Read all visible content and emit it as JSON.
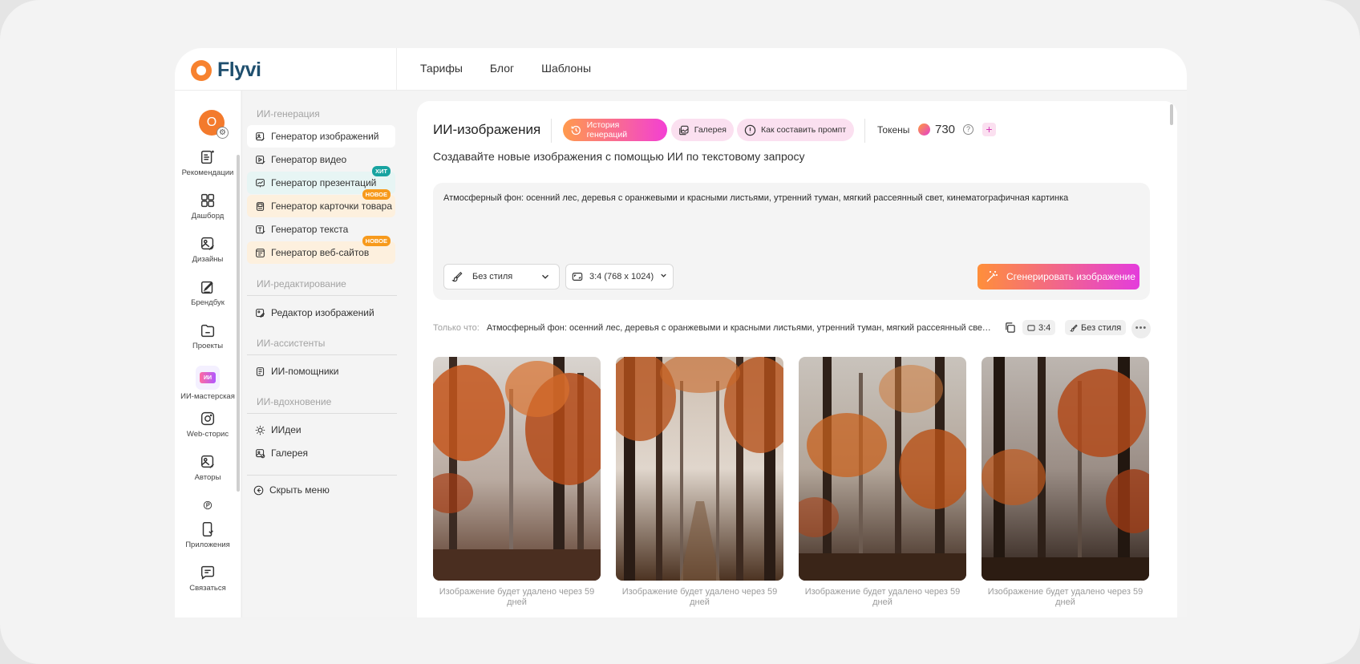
{
  "brand": {
    "name": "Flyvi"
  },
  "nav": [
    "Тарифы",
    "Блог",
    "Шаблоны"
  ],
  "avatar": {
    "letter": "O"
  },
  "rail": {
    "items": [
      {
        "label": "Рекомендации",
        "icon": "recommendations-icon"
      },
      {
        "label": "Дашборд",
        "icon": "dashboard-icon"
      },
      {
        "label": "Дизайны",
        "icon": "designs-icon"
      },
      {
        "label": "Брендбук",
        "icon": "brandbook-icon"
      },
      {
        "label": "Проекты",
        "icon": "folder-icon"
      },
      {
        "label": "ИИ-мастерская",
        "icon": "ai-workshop-icon",
        "badge": "ИИ"
      },
      {
        "label": "Web-сторис",
        "icon": "instagram-icon"
      },
      {
        "label": "Авторы",
        "icon": "authors-icon"
      },
      {
        "label": "Приложения",
        "icon": "phone-icon"
      },
      {
        "label": "Связаться",
        "icon": "chat-icon"
      }
    ]
  },
  "menu": {
    "sections": {
      "generation": "ИИ-генерация",
      "editing": "ИИ-редактирование",
      "assistants": "ИИ-ассистенты",
      "inspiration": "ИИ-вдохновение"
    },
    "items": {
      "image_gen": "Генератор изображений",
      "video_gen": "Генератор видео",
      "presentation_gen": "Генератор презентаций",
      "product_card_gen": "Генератор карточки товара",
      "text_gen": "Генератор текста",
      "website_gen": "Генератор веб-сайтов",
      "image_editor": "Редактор изображений",
      "assistants": "ИИ-помощники",
      "ideas": "ИИдеи",
      "gallery": "Галерея"
    },
    "badges": {
      "hit": "ХИТ",
      "new": "НОВОЕ"
    },
    "hide": "Скрыть меню"
  },
  "main": {
    "title": "ИИ-изображения",
    "buttons": {
      "history": "История генераций",
      "gallery": "Галерея",
      "howto": "Как составить промпт"
    },
    "tokens": {
      "label": "Токены",
      "value": "730"
    },
    "subtitle": "Создавайте новые изображения с помощью ИИ по текстовому запросу",
    "prompt": "Атмосферный фон: осенний лес, деревья с оранжевыми и красными листьями, утренний туман, мягкий рассеянный свет, кинематографичная картинка",
    "style_select": "Без стиля",
    "ratio_select": "3:4 (768 x 1024)",
    "generate": "Сгенерировать изображение",
    "recent": {
      "label": "Только что:",
      "text": "Атмосферный фон: осенний лес, деревья с оранжевыми и красными листьями, утренний туман, мягкий рассеянный свет, кинематографичная картинка",
      "ratio": "3:4",
      "style": "Без стиля"
    },
    "caption": "Изображение будет удалено через 59 дней"
  },
  "colors": {
    "accent_orange": "#f7822f",
    "accent_pink": "#e43cdc",
    "brand_text": "#1f4f6e"
  }
}
